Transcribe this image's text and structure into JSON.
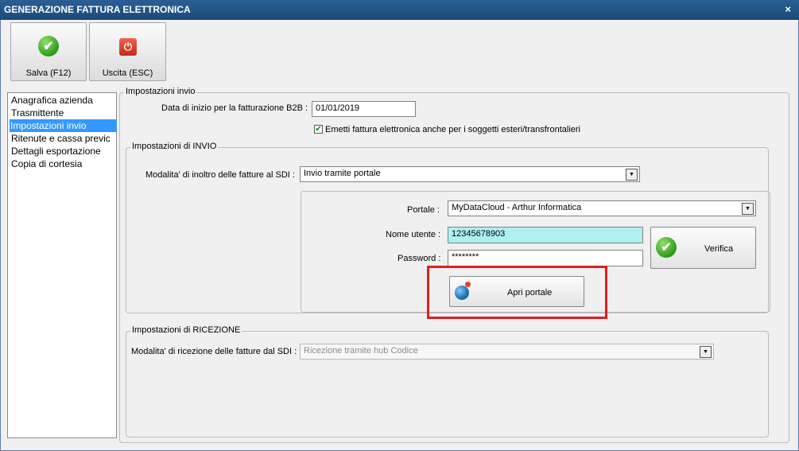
{
  "window": {
    "title": "GENERAZIONE FATTURA ELETTRONICA",
    "close_glyph": "×"
  },
  "toolbar": {
    "save": {
      "label": "Salva (F12)",
      "icon": "green-check-icon",
      "glyph": "✔"
    },
    "exit": {
      "label": "Uscita (ESC)",
      "icon": "power-stop-icon",
      "glyph": "⏻"
    }
  },
  "nav": {
    "items": [
      {
        "label": "Anagrafica azienda"
      },
      {
        "label": "Trasmittente"
      },
      {
        "label": "Impostazioni invio"
      },
      {
        "label": "Ritenute e cassa previc"
      },
      {
        "label": "Dettagli esportazione"
      },
      {
        "label": "Copia di cortesia"
      }
    ],
    "selected": "Impostazioni invio"
  },
  "settings": {
    "group_label": "Impostazioni invio",
    "b2b_label": "Data di inizio per la fatturazione B2B :",
    "b2b_value": "01/01/2019",
    "foreign_label": "Emetti fattura elettronica anche per i soggetti esteri/transfrontalieri",
    "foreign_checked": true,
    "check_glyph": "✔"
  },
  "send": {
    "group_label": "Impostazioni di INVIO",
    "mode_label": "Modalita' di inoltro delle fatture al SDI :",
    "mode_value": "Invio tramite portale",
    "portal_label": "Portale :",
    "portal_value": "MyDataCloud - Arthur Informatica",
    "user_label": "Nome utente :",
    "user_value": "12345678903",
    "password_label": "Password :",
    "password_value": "********",
    "verify_label": "Verifica",
    "open_portal_label": "Apri portale",
    "arrow_glyph": "▼"
  },
  "receive": {
    "group_label": "Impostazioni di RICEZIONE",
    "mode_label": "Modalita' di ricezione delle fatture dal SDI :",
    "mode_value": "Ricezione tramite hub Codice"
  },
  "colors": {
    "titlebar": "#1f4f82",
    "selection": "#3399ff",
    "highlight_field": "#aeeff2",
    "annotation_box": "#e02020"
  }
}
